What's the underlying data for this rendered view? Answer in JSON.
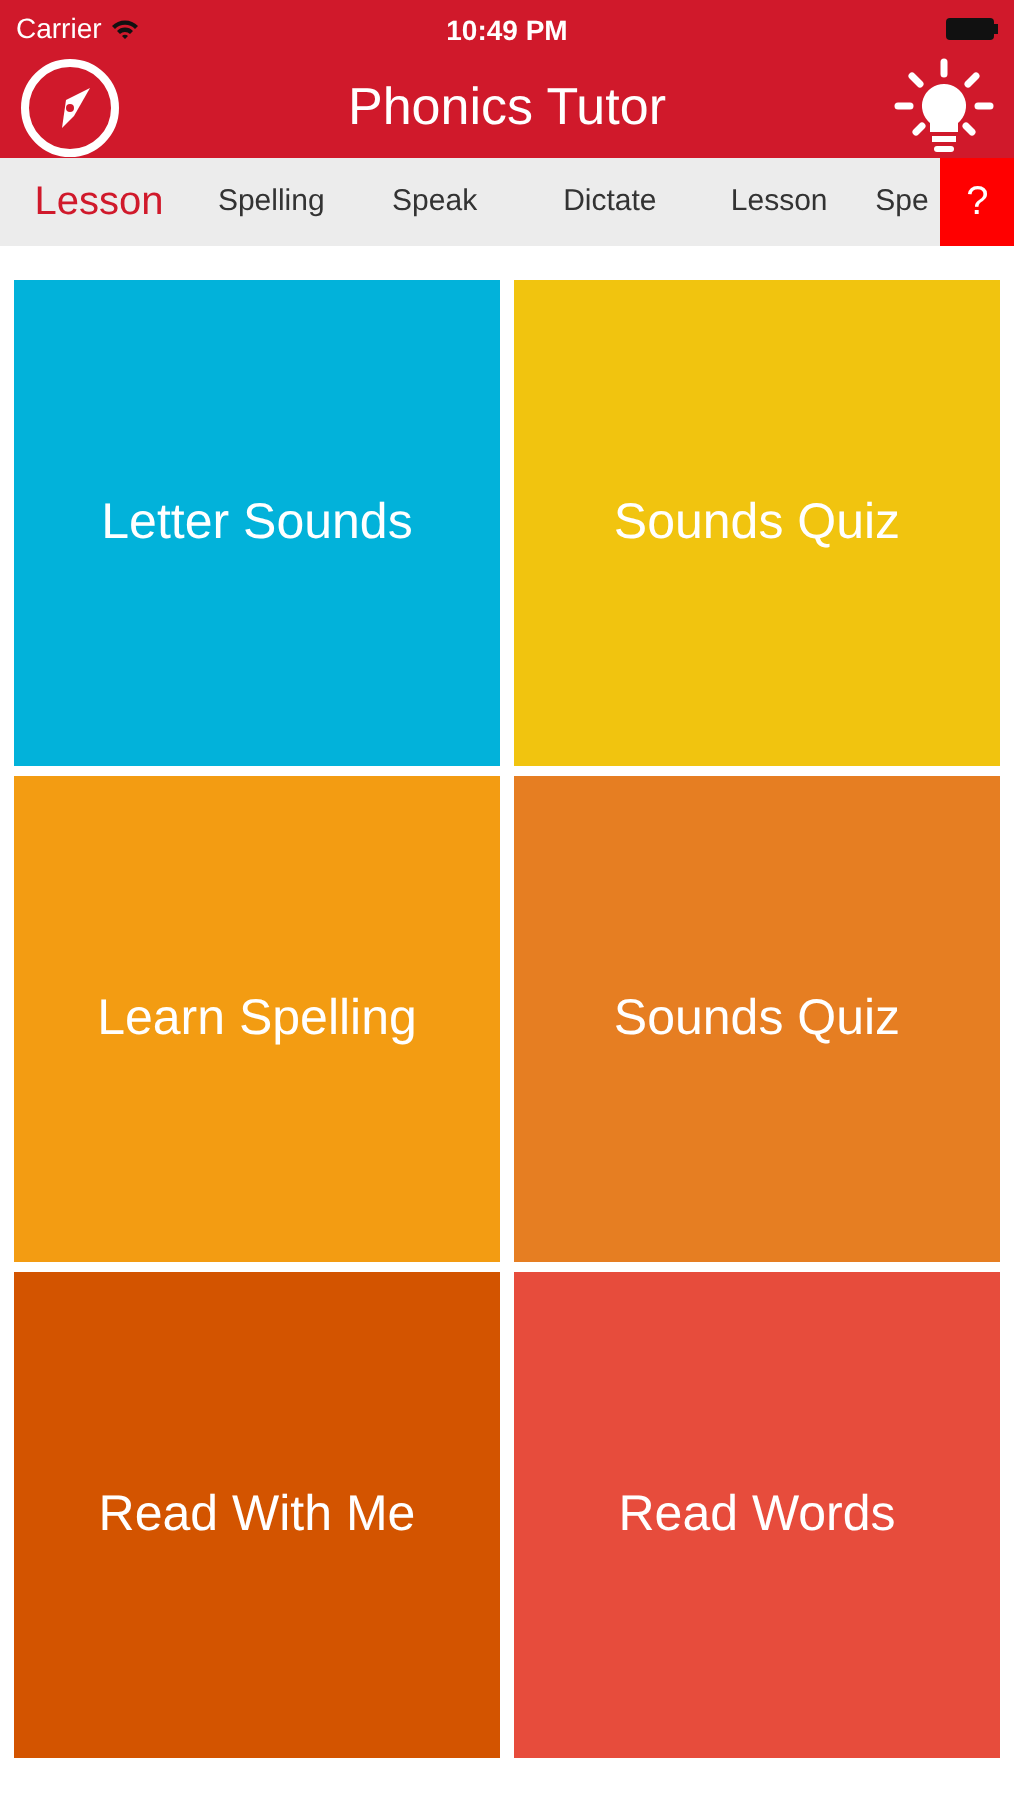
{
  "status_bar": {
    "carrier": "Carrier",
    "time": "10:49 PM"
  },
  "nav": {
    "title": "Phonics Tutor"
  },
  "tabs": [
    {
      "label": "Lesson",
      "selected": true
    },
    {
      "label": "Spelling",
      "selected": false
    },
    {
      "label": "Speak",
      "selected": false
    },
    {
      "label": "Dictate",
      "selected": false
    },
    {
      "label": "Lesson",
      "selected": false
    },
    {
      "label": "Spe",
      "selected": false
    }
  ],
  "help_button": "?",
  "tiles": [
    {
      "label": "Letter Sounds",
      "color": "#02b2da"
    },
    {
      "label": "Sounds Quiz",
      "color": "#f1c40f"
    },
    {
      "label": "Learn Spelling",
      "color": "#f39c12"
    },
    {
      "label": "Sounds Quiz",
      "color": "#e67e22"
    },
    {
      "label": "Read With Me",
      "color": "#d35400"
    },
    {
      "label": "Read Words",
      "color": "#e74c3c"
    }
  ]
}
